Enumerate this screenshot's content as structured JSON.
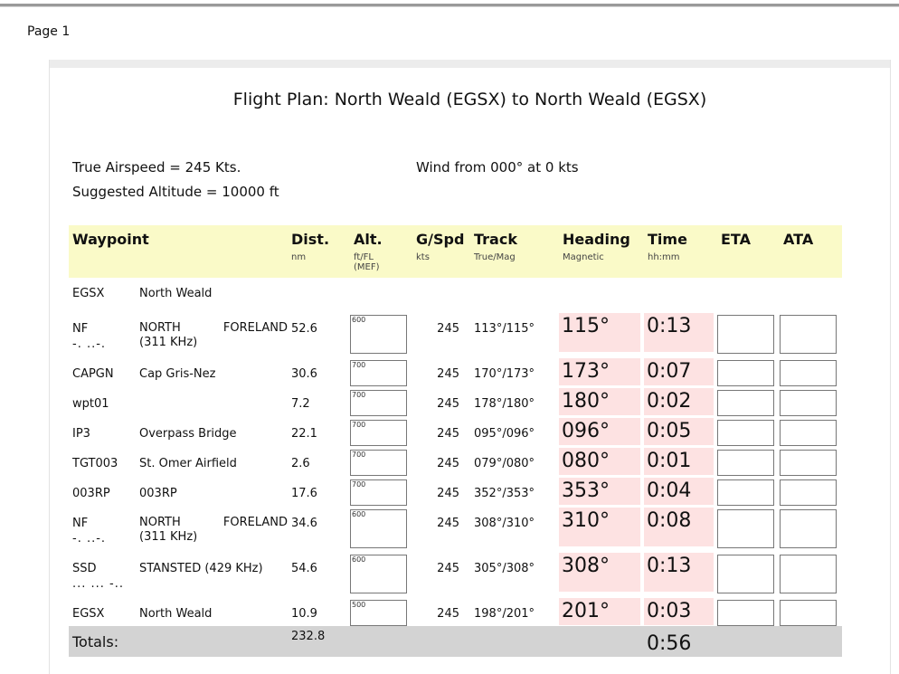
{
  "page": {
    "label": "Page 1"
  },
  "plan": {
    "title": "Flight Plan: North Weald (EGSX) to North Weald (EGSX)",
    "true_airspeed": "True Airspeed = 245 Kts.",
    "suggested_altitude": "Suggested Altitude = 10000 ft",
    "wind": "Wind from 000° at 0 kts"
  },
  "headers": {
    "waypoint": "Waypoint",
    "dist": "Dist.",
    "dist_unit": "nm",
    "alt": "Alt.",
    "alt_unit": "ft/FL (MEF)",
    "gspd": "G/Spd",
    "gspd_unit": "kts",
    "track": "Track",
    "track_unit": "True/Mag",
    "heading": "Heading",
    "heading_unit": "Magnetic",
    "time": "Time",
    "time_unit": "hh:mm",
    "eta": "ETA",
    "ata": "ATA"
  },
  "start": {
    "id": "EGSX",
    "name": "North Weald"
  },
  "rows": [
    {
      "id": "NF",
      "sub": "-. ..-.",
      "name1": "NORTH",
      "name2": "FORELAND",
      "name3": "(311 KHz)",
      "dist": "52.6",
      "mef": "600",
      "gspd": "245",
      "track": "113°/115°",
      "heading": "115°",
      "time": "0:13"
    },
    {
      "id": "CAPGN",
      "sub": "",
      "name1": "Cap Gris-Nez",
      "name2": "",
      "name3": "",
      "dist": "30.6",
      "mef": "700",
      "gspd": "245",
      "track": "170°/173°",
      "heading": "173°",
      "time": "0:07"
    },
    {
      "id": "wpt01",
      "sub": "",
      "name1": "",
      "name2": "",
      "name3": "",
      "dist": "7.2",
      "mef": "700",
      "gspd": "245",
      "track": "178°/180°",
      "heading": "180°",
      "time": "0:02"
    },
    {
      "id": "IP3",
      "sub": "",
      "name1": "Overpass Bridge",
      "name2": "",
      "name3": "",
      "dist": "22.1",
      "mef": "700",
      "gspd": "245",
      "track": "095°/096°",
      "heading": "096°",
      "time": "0:05"
    },
    {
      "id": "TGT003",
      "sub": "",
      "name1": "St. Omer Airfield",
      "name2": "",
      "name3": "",
      "dist": "2.6",
      "mef": "700",
      "gspd": "245",
      "track": "079°/080°",
      "heading": "080°",
      "time": "0:01"
    },
    {
      "id": "003RP",
      "sub": "",
      "name1": "003RP",
      "name2": "",
      "name3": "",
      "dist": "17.6",
      "mef": "700",
      "gspd": "245",
      "track": "352°/353°",
      "heading": "353°",
      "time": "0:04"
    },
    {
      "id": "NF",
      "sub": "-. ..-.",
      "name1": "NORTH",
      "name2": "FORELAND",
      "name3": "(311 KHz)",
      "dist": "34.6",
      "mef": "600",
      "gspd": "245",
      "track": "308°/310°",
      "heading": "310°",
      "time": "0:08"
    },
    {
      "id": "SSD",
      "sub": "... ... -..",
      "name1": "STANSTED (429 KHz)",
      "name2": "",
      "name3": "",
      "dist": "54.6",
      "mef": "600",
      "gspd": "245",
      "track": "305°/308°",
      "heading": "308°",
      "time": "0:13"
    },
    {
      "id": "EGSX",
      "sub": "",
      "name1": "North Weald",
      "name2": "",
      "name3": "",
      "dist": "10.9",
      "mef": "500",
      "gspd": "245",
      "track": "198°/201°",
      "heading": "201°",
      "time": "0:03"
    }
  ],
  "totals": {
    "label": "Totals:",
    "dist": "232.8",
    "time": "0:56"
  }
}
